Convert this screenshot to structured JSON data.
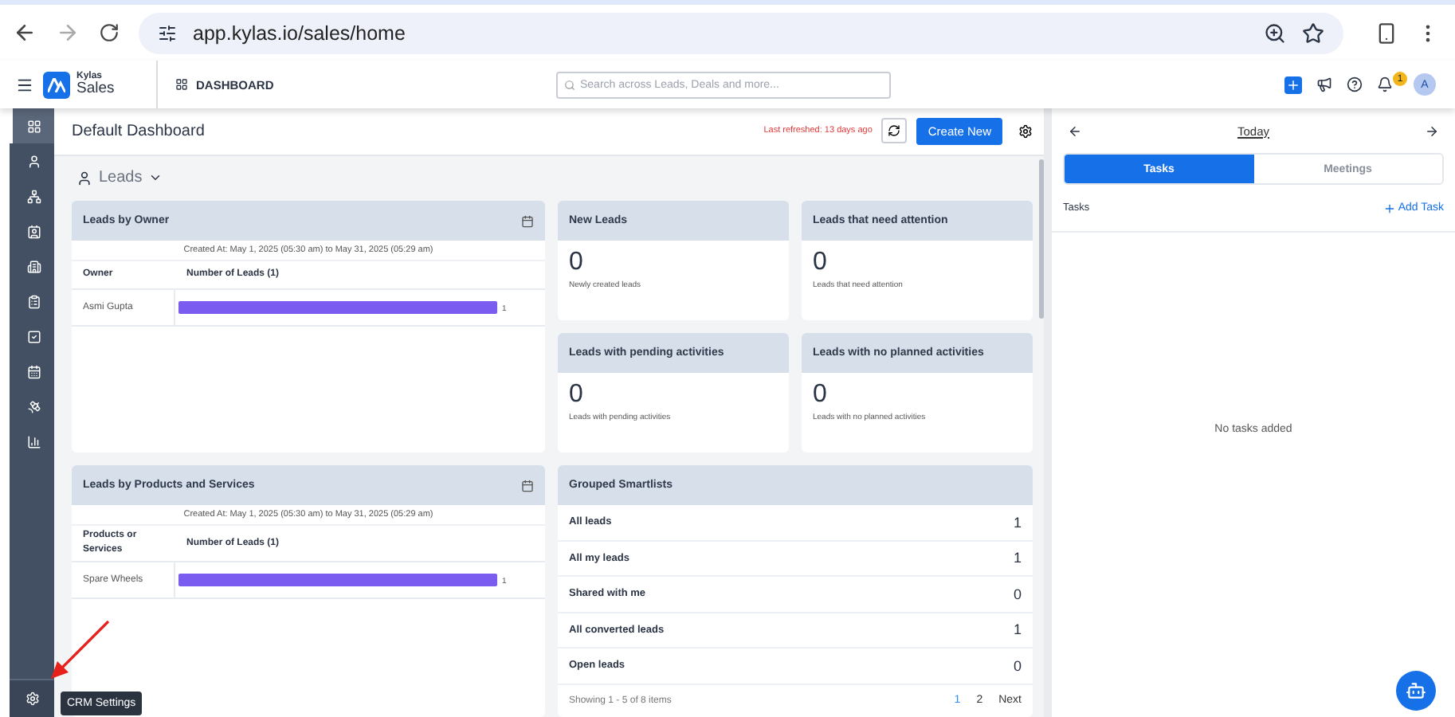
{
  "browser": {
    "url": "app.kylas.io/sales/home"
  },
  "header": {
    "brand_top": "Kylas",
    "brand_bottom": "Sales",
    "section": "DASHBOARD",
    "search": {
      "placeholder": "Search across Leads, Deals and more..."
    },
    "notification_count": "1",
    "avatar": "A"
  },
  "sidebar": {
    "items": [
      {
        "selected": true
      },
      {
        "selected": false
      },
      {
        "selected": false
      },
      {
        "selected": false
      },
      {
        "selected": false
      },
      {
        "selected": false
      },
      {
        "selected": false
      },
      {
        "selected": false
      },
      {
        "selected": false
      },
      {
        "selected": false
      }
    ],
    "tooltip": "CRM Settings"
  },
  "dashboard": {
    "title": "Default Dashboard",
    "last_refreshed": "Last refreshed: 13 days ago",
    "create_button": "Create New",
    "entity": "Leads",
    "bar_cards": [
      {
        "title": "Leads by Owner",
        "subtitle": "Created At: May 1, 2025 (05:30 am) to May 31, 2025 (05:29 am)",
        "columns": [
          "Owner",
          "Number of Leads (1)"
        ],
        "chart_data": {
          "type": "bar",
          "orientation": "horizontal",
          "categories": [
            "Asmi Gupta"
          ],
          "values": [
            1
          ],
          "data_labels": true
        }
      },
      {
        "title": "Leads by Products and Services",
        "subtitle": "Created At: May 1, 2025 (05:30 am) to May 31, 2025 (05:29 am)",
        "columns": [
          "Products or Services",
          "Number of Leads (1)"
        ],
        "chart_data": {
          "type": "bar",
          "orientation": "horizontal",
          "categories": [
            "Spare Wheels"
          ],
          "values": [
            1
          ],
          "data_labels": true
        }
      }
    ],
    "stat_cards": [
      {
        "title": "New Leads",
        "value": "0",
        "caption": "Newly created leads"
      },
      {
        "title": "Leads that need attention",
        "value": "0",
        "caption": "Leads that need attention"
      },
      {
        "title": "Leads with pending activities",
        "value": "0",
        "caption": "Leads with pending activities"
      },
      {
        "title": "Leads with no planned activities",
        "value": "0",
        "caption": "Leads with no planned activities"
      }
    ],
    "smartlists": {
      "title": "Grouped Smartlists",
      "rows": [
        {
          "name": "All leads",
          "count": "1"
        },
        {
          "name": "All my leads",
          "count": "1"
        },
        {
          "name": "Shared with me",
          "count": "0"
        },
        {
          "name": "All converted leads",
          "count": "1"
        },
        {
          "name": "Open leads",
          "count": "0"
        }
      ],
      "summary": "Showing 1 - 5 of 8 items",
      "pages": [
        {
          "label": "1",
          "selected": true
        },
        {
          "label": "2",
          "selected": false
        }
      ],
      "next": "Next"
    }
  },
  "right_panel": {
    "date": "Today",
    "tabs": [
      {
        "label": "Tasks",
        "selected": true
      },
      {
        "label": "Meetings",
        "selected": false
      }
    ],
    "list_label": "Tasks",
    "add_link": "Add Task",
    "empty_text": "No tasks added"
  }
}
